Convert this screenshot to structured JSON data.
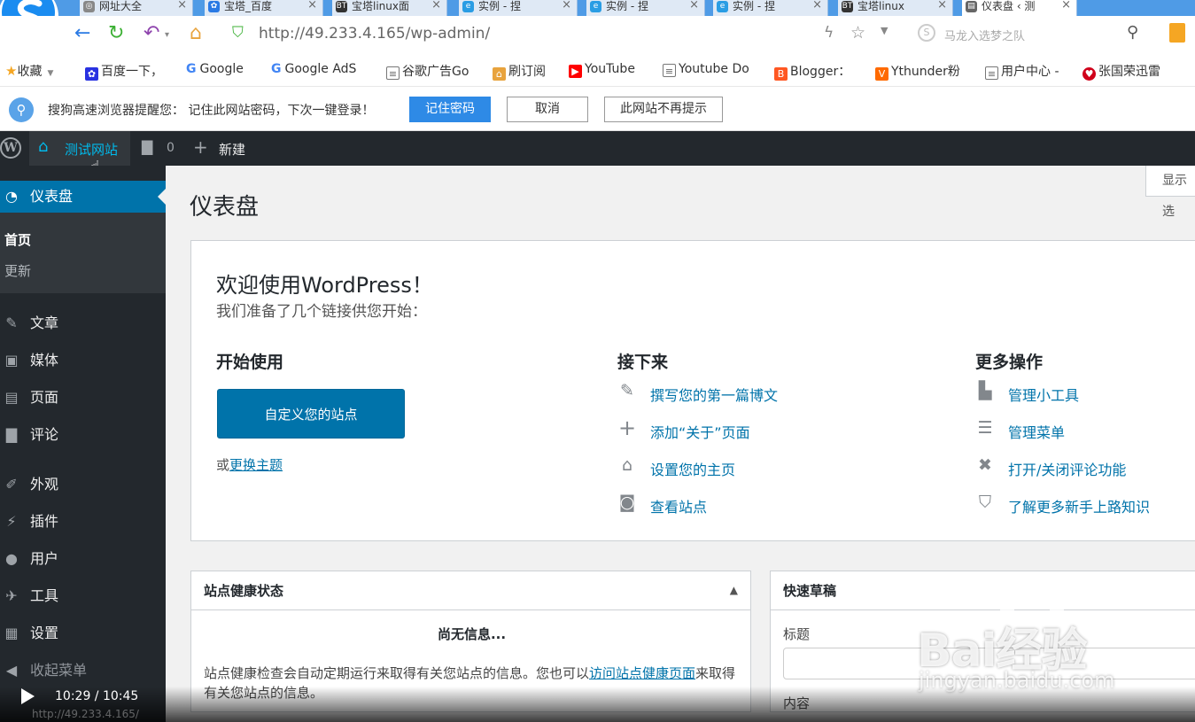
{
  "browser": {
    "tabs": [
      {
        "label": "网址大全",
        "icon_color": "#888888",
        "active": false
      },
      {
        "label": "宝塔_百度",
        "icon_color": "#2a7ae4",
        "active": false
      },
      {
        "label": "宝塔linux面",
        "icon_color": "#333333",
        "active": false
      },
      {
        "label": "实例 - 捏",
        "icon_color": "#2a9de4",
        "active": false
      },
      {
        "label": "实例 - 捏",
        "icon_color": "#2a9de4",
        "active": false
      },
      {
        "label": "实例 - 捏",
        "icon_color": "#2a9de4",
        "active": false
      },
      {
        "label": "宝塔linux",
        "icon_color": "#333333",
        "active": false
      },
      {
        "label": "仪表盘 ‹ 测",
        "icon_color": "#666666",
        "active": true
      }
    ],
    "url": "http://49.233.4.165/wp-admin/",
    "search_placeholder": "马龙入选梦之队",
    "bookmarks": [
      {
        "label": "收藏",
        "icon": "star-icon",
        "color": "#f5a623"
      },
      {
        "label": "百度一下，",
        "icon": "paw-icon",
        "color": "#2932e1"
      },
      {
        "label": "Google",
        "icon": "google-icon",
        "color": "#4285f4"
      },
      {
        "label": "Google AdS",
        "icon": "google-icon",
        "color": "#4285f4"
      },
      {
        "label": "谷歌广告Go",
        "icon": "page-icon",
        "color": "#666666"
      },
      {
        "label": "刷订阅",
        "icon": "home-icon",
        "color": "#e8a33d"
      },
      {
        "label": "YouTube",
        "icon": "youtube-icon",
        "color": "#ff0000"
      },
      {
        "label": "Youtube Do",
        "icon": "page-icon",
        "color": "#666666"
      },
      {
        "label": "Blogger：",
        "icon": "blogger-icon",
        "color": "#ff5722"
      },
      {
        "label": "Ythunder粉",
        "icon": "v-icon",
        "color": "#ff6a00"
      },
      {
        "label": "用户中心 -",
        "icon": "page-icon",
        "color": "#666666"
      },
      {
        "label": "张国荣迅雷",
        "icon": "heart-icon",
        "color": "#d0021b"
      }
    ],
    "password_prompt": {
      "message": "搜狗高速浏览器提醒您：  记住此网站密码，下次一键登录！",
      "remember": "记住密码",
      "cancel": "取消",
      "never": "此网站不再提示"
    }
  },
  "adminbar": {
    "site_name": "测试网站",
    "comments_count": "0",
    "new_label": "新建"
  },
  "sidebar": {
    "dashboard": "仪表盘",
    "sub_home": "首页",
    "sub_updates": "更新",
    "items": [
      {
        "label": "文章",
        "icon": "pin-icon"
      },
      {
        "label": "媒体",
        "icon": "media-icon"
      },
      {
        "label": "页面",
        "icon": "page-icon"
      },
      {
        "label": "评论",
        "icon": "comment-icon"
      },
      {
        "label": "外观",
        "icon": "brush-icon"
      },
      {
        "label": "插件",
        "icon": "plugin-icon"
      },
      {
        "label": "用户",
        "icon": "user-icon"
      },
      {
        "label": "工具",
        "icon": "wrench-icon"
      },
      {
        "label": "设置",
        "icon": "settings-icon"
      },
      {
        "label": "收起菜单",
        "icon": "collapse-icon"
      }
    ]
  },
  "main": {
    "title": "仪表盘",
    "screen_options": "显示选",
    "welcome": {
      "heading": "欢迎使用WordPress！",
      "subheading": "我们准备了几个链接供您开始：",
      "get_started": "开始使用",
      "customize_button": "自定义您的站点",
      "or_text": "或",
      "change_theme": "更换主题",
      "next_steps": "接下来",
      "next_links": [
        {
          "label": "撰写您的第一篇博文",
          "icon": "edit-icon"
        },
        {
          "label": "添加“关于”页面",
          "icon": "plus-icon"
        },
        {
          "label": "设置您的主页",
          "icon": "home-icon"
        },
        {
          "label": "查看站点",
          "icon": "view-icon"
        }
      ],
      "more_actions": "更多操作",
      "more_links": [
        {
          "label": "管理小工具",
          "icon": "widgets-icon"
        },
        {
          "label": "管理菜单",
          "icon": "menu-icon"
        },
        {
          "label": "打开/关闭评论功能",
          "icon": "comment-toggle-icon"
        },
        {
          "label": "了解更多新手上路知识",
          "icon": "learn-icon"
        }
      ]
    },
    "site_health": {
      "title": "站点健康状态",
      "no_info": "尚无信息...",
      "desc_prefix": "站点健康检查会自动定期运行来取得有关您站点的信息。您也可以",
      "desc_link": "访问站点健康页面",
      "desc_suffix": "来取得有关您站点的信息。"
    },
    "quick_draft": {
      "title": "快速草稿",
      "title_label": "标题",
      "content_label": "内容"
    }
  },
  "video": {
    "time": "10:29 / 10:45",
    "status_url": "http://49.233.4.165/"
  },
  "watermark": {
    "brand": "Bai经验",
    "domain": "jingyan.baidu.com"
  }
}
